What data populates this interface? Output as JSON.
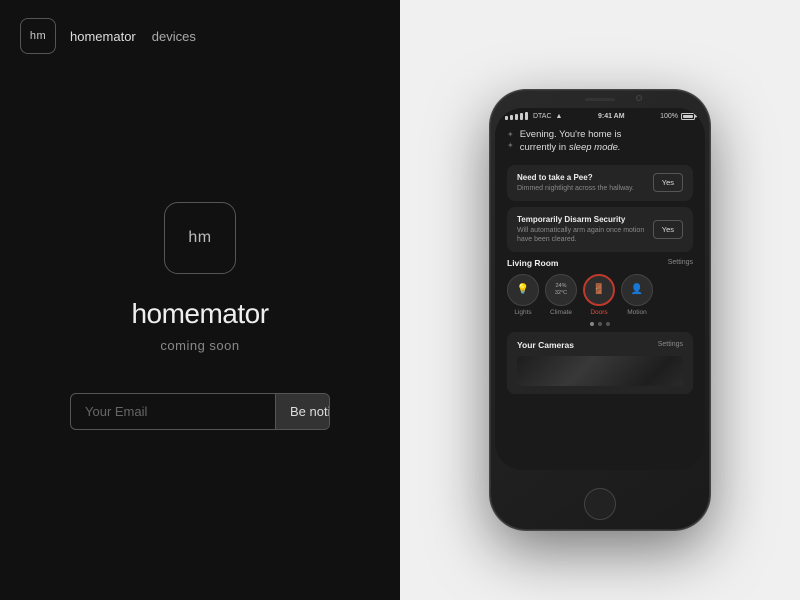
{
  "nav": {
    "logo_text": "hm",
    "links": [
      {
        "label": "homemator",
        "active": true
      },
      {
        "label": "devices",
        "active": false
      }
    ]
  },
  "left": {
    "icon_text": "hm",
    "app_name": "homemator",
    "coming_soon": "coming soon",
    "email_placeholder": "Your Email",
    "notify_button": "Be notified"
  },
  "phone": {
    "status_bar": {
      "carrier": "DTAC",
      "time": "9:41 AM",
      "battery": "100%"
    },
    "greeting": {
      "line1": "Evening. You're home is",
      "line2_normal": "currently in",
      "line2_italic": "sleep mode."
    },
    "actions": [
      {
        "title": "Need to take a Pee?",
        "subtitle": "Dimmed nightlight across the hallway.",
        "button": "Yes"
      },
      {
        "title": "Temporarily Disarm Security",
        "subtitle": "Will automatically arm again once motion have been cleared.",
        "button": "Yes"
      }
    ],
    "living_room": {
      "title": "Living Room",
      "settings": "Settings",
      "controls": [
        {
          "icon": "💡",
          "label": "Lights",
          "sublabel": "",
          "active": false
        },
        {
          "icon": "24%\n32°C",
          "label": "Climate",
          "sublabel": "",
          "active": false
        },
        {
          "icon": "🚪",
          "label": "Doors",
          "sublabel": "",
          "active": true
        },
        {
          "icon": "👤",
          "label": "Motion",
          "sublabel": "",
          "active": false
        }
      ]
    },
    "cameras": {
      "title": "Your Cameras",
      "settings": "Settings"
    }
  }
}
